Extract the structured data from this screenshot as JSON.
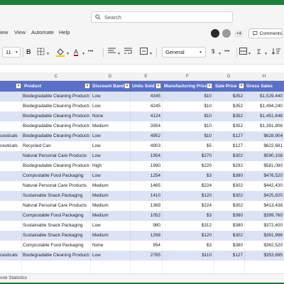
{
  "titlebar": {
    "search_placeholder": "Search"
  },
  "menu": {
    "items": [
      "iew",
      "View",
      "Automate",
      "Help"
    ],
    "badge": "+4",
    "comments": "Comments"
  },
  "toolbar": {
    "font_size": "11",
    "number_format": "General"
  },
  "columns": {
    "letters": [
      "C",
      "D",
      "E",
      "F",
      "G",
      "H"
    ]
  },
  "table": {
    "headers": [
      "Product",
      "Discount Band",
      "Units Sold",
      "Manufacturing Price",
      "Sale Price",
      "Gross Sales"
    ],
    "rows": [
      {
        "a": "",
        "product": "Biodegradable Cleaning Products",
        "band": "Low",
        "units": "4345",
        "mfg": "$10",
        "sale": "$352",
        "gross": "$1,529,440"
      },
      {
        "a": "",
        "product": "Biodegradable Cleaning Products",
        "band": "Low",
        "units": "4245",
        "mfg": "$10",
        "sale": "$352",
        "gross": "$1,494,240"
      },
      {
        "a": "",
        "product": "Biodegradable Cleaning Products",
        "band": "None",
        "units": "4124",
        "mfg": "$10",
        "sale": "$352",
        "gross": "$1,451,648"
      },
      {
        "a": "",
        "product": "Biodegradable Cleaning Products",
        "band": "Medium",
        "units": "3954",
        "mfg": "$10",
        "sale": "$352",
        "gross": "$1,391,808"
      },
      {
        "a": "ceuticals",
        "product": "Biodegradable Cleaning Products",
        "band": "Low",
        "units": "4952",
        "mfg": "$10",
        "sale": "$127",
        "gross": "$628,904"
      },
      {
        "a": "ceuticals",
        "product": "Recycled Can",
        "band": "Low",
        "units": "4903",
        "mfg": "$5",
        "sale": "$127",
        "gross": "$622,681"
      },
      {
        "a": "",
        "product": "Natural Personal Care Products",
        "band": "Low",
        "units": "1954",
        "mfg": "$270",
        "sale": "$302",
        "gross": "$590,108"
      },
      {
        "a": "",
        "product": "Biodegradable Cleaning Products",
        "band": "High",
        "units": "1990",
        "mfg": "$220",
        "sale": "$292",
        "gross": "$581,080"
      },
      {
        "a": "",
        "product": "Compostable Food Packaging",
        "band": "Low",
        "units": "1254",
        "mfg": "$3",
        "sale": "$380",
        "gross": "$476,520"
      },
      {
        "a": "",
        "product": "Natural Personal Care Products",
        "band": "Medium",
        "units": "1465",
        "mfg": "$224",
        "sale": "$302",
        "gross": "$442,430"
      },
      {
        "a": "",
        "product": "Sustainable Snack Packaging",
        "band": "Medium",
        "units": "1410",
        "mfg": "$120",
        "sale": "$302",
        "gross": "$425,820"
      },
      {
        "a": "",
        "product": "Natural Personal Care Products",
        "band": "Medium",
        "units": "1369",
        "mfg": "$224",
        "sale": "$302",
        "gross": "$413,438"
      },
      {
        "a": "",
        "product": "Compostable Food Packaging",
        "band": "Medium",
        "units": "1052",
        "mfg": "$3",
        "sale": "$380",
        "gross": "$399,760"
      },
      {
        "a": "",
        "product": "Sustainable Snack Packaging",
        "band": "Low",
        "units": "980",
        "mfg": "$312",
        "sale": "$380",
        "gross": "$372,400"
      },
      {
        "a": "",
        "product": "Sustainable Snack Packaging",
        "band": "Medium",
        "units": "1298",
        "mfg": "$120",
        "sale": "$302",
        "gross": "$391,996"
      },
      {
        "a": "",
        "product": "Compostable Food Packaging",
        "band": "None",
        "units": "954",
        "mfg": "$3",
        "sale": "$380",
        "gross": "$362,520"
      },
      {
        "a": "ceuticals",
        "product": "Biodegradable Cleaning Products",
        "band": "Low",
        "units": "2785",
        "mfg": "$110",
        "sale": "$127",
        "gross": "$353,695"
      }
    ]
  },
  "status": {
    "text": "ook Statistics"
  },
  "colors": {
    "header_bg": "#5b70c6",
    "band_row": "#dce3f4",
    "frame": "#1e7d3c"
  }
}
